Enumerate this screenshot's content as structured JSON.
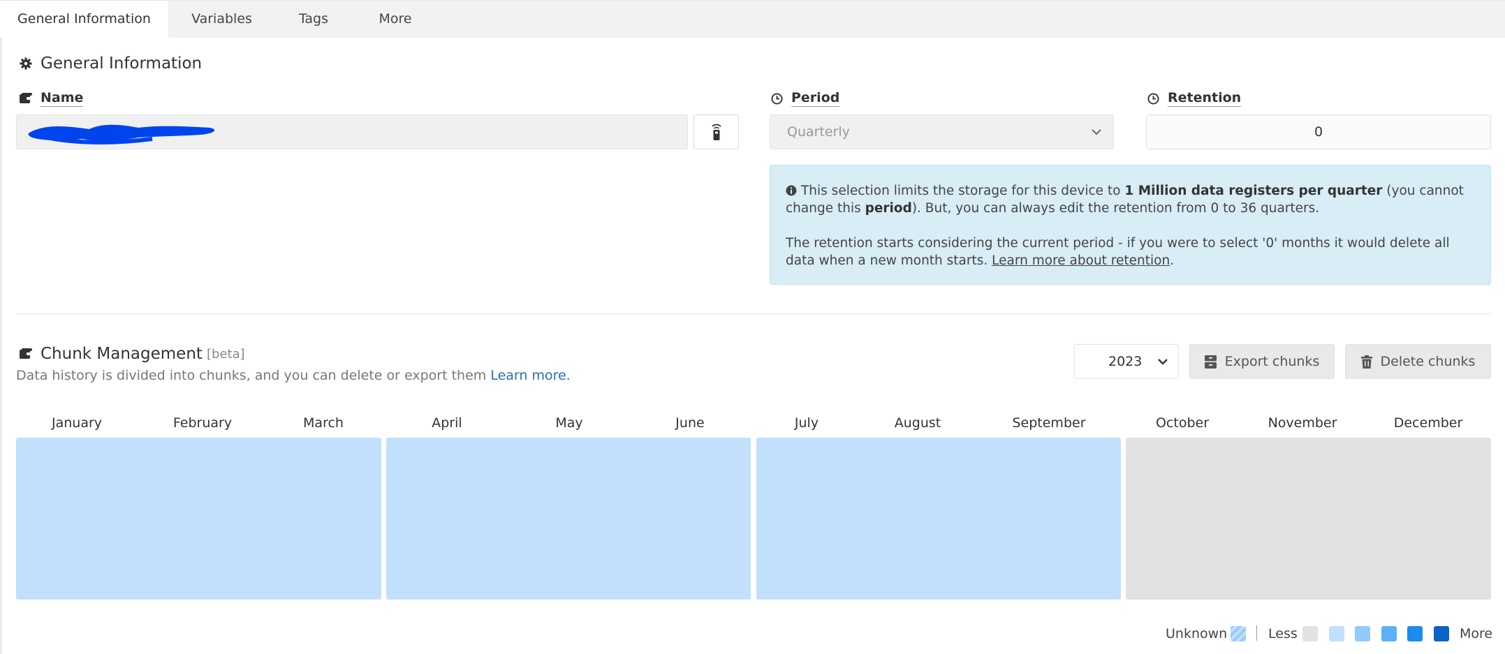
{
  "tabs": [
    {
      "label": "General Information",
      "active": true
    },
    {
      "label": "Variables",
      "active": false
    },
    {
      "label": "Tags",
      "active": false
    },
    {
      "label": "More",
      "active": false
    }
  ],
  "general": {
    "title": "General Information",
    "name_label": "Name",
    "name_value": "",
    "period_label": "Period",
    "period_value": "Quarterly",
    "retention_label": "Retention",
    "retention_value": "0",
    "info": {
      "t1": "This selection limits the storage for this device to ",
      "b1": "1 Million data registers per quarter",
      "t2": " (you cannot change this ",
      "b2": "period",
      "t3": "). But, you can always edit the retention from 0 to 36 quarters.",
      "p2": "The retention starts considering the current period - if you were to select '0' months it would delete all data when a new month starts. ",
      "link": "Learn more about retention",
      "end": "."
    }
  },
  "chunks": {
    "title": "Chunk Management",
    "beta": "[beta]",
    "subtitle": "Data history is divided into chunks, and you can delete or export them ",
    "learn_more": "Learn more.",
    "year": "2023",
    "export_label": "Export chunks",
    "delete_label": "Delete chunks",
    "months": [
      "January",
      "February",
      "March",
      "April",
      "May",
      "June",
      "July",
      "August",
      "September",
      "October",
      "November",
      "December"
    ],
    "quarter_colors": [
      "#c2e0fb",
      "#c2e0fb",
      "#c2e0fb",
      "#e1e1e1"
    ]
  },
  "legend": {
    "unknown": "Unknown",
    "less": "Less",
    "more": "More",
    "colors": [
      "#e1e1e1",
      "#c2e0fb",
      "#93cafd",
      "#5db0f7",
      "#1a8cf0",
      "#0a64c8"
    ]
  },
  "colors": {
    "info_bg": "#d9edf7",
    "link": "#2a6fb0",
    "redaction": "#0044ee"
  }
}
